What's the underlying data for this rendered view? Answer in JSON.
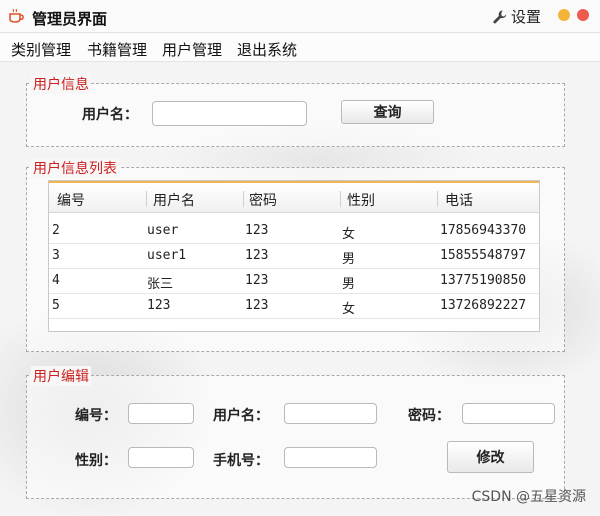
{
  "window": {
    "title": "管理员界面",
    "settings_label": "设置"
  },
  "menu": [
    "类别管理",
    "书籍管理",
    "用户管理",
    "退出系统"
  ],
  "user_info": {
    "title": "用户信息",
    "username_label": "用户名：",
    "username_value": "",
    "query_button": "查询"
  },
  "user_list": {
    "title": "用户信息列表",
    "columns": [
      "编号",
      "用户名",
      "密码",
      "性别",
      "电话"
    ],
    "rows": [
      [
        "2",
        "user",
        "123",
        "女",
        "17856943370"
      ],
      [
        "3",
        "user1",
        "123",
        "男",
        "15855548797"
      ],
      [
        "4",
        "张三",
        "123",
        "男",
        "13775190850"
      ],
      [
        "5",
        "123",
        "123",
        "女",
        "13726892227"
      ]
    ]
  },
  "user_edit": {
    "title": "用户编辑",
    "id_label": "编号：",
    "username_label": "用户名：",
    "password_label": "密码：",
    "gender_label": "性别：",
    "phone_label": "手机号：",
    "modify_button": "修改"
  },
  "watermark": "CSDN @五星资源",
  "colors": {
    "group_title": "#cc2020",
    "table_header_accent": "#f0b555",
    "minimize": "#f4b43a",
    "close": "#ef5a4f"
  }
}
